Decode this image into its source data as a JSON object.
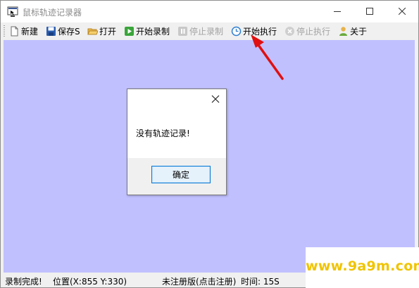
{
  "window": {
    "title": "鼠标轨迹记录器"
  },
  "toolbar": {
    "items": [
      {
        "label": "新建",
        "icon": "new-file-icon",
        "enabled": true
      },
      {
        "label": "保存S",
        "icon": "save-disk-icon",
        "enabled": true
      },
      {
        "label": "打开",
        "icon": "open-folder-icon",
        "enabled": true
      },
      {
        "label": "开始录制",
        "icon": "play-record-icon",
        "enabled": true
      },
      {
        "label": "停止录制",
        "icon": "pause-icon",
        "enabled": false
      },
      {
        "label": "开始执行",
        "icon": "clock-icon",
        "enabled": true
      },
      {
        "label": "停止执行",
        "icon": "stop-x-icon",
        "enabled": false
      },
      {
        "label": "关于",
        "icon": "user-icon",
        "enabled": true
      }
    ]
  },
  "dialog": {
    "message": "没有轨迹记录!",
    "ok_label": "确定"
  },
  "statusbar": {
    "status": "录制完成!",
    "position": "位置(X:855 Y:330)",
    "registration": "未注册版(点击注册)",
    "time": "时间: 15S"
  },
  "watermark": {
    "text": "www.9a9m.com"
  },
  "colors": {
    "canvas_bg": "#c0c0ff",
    "arrow": "#e01010",
    "watermark": "#f0c400"
  }
}
